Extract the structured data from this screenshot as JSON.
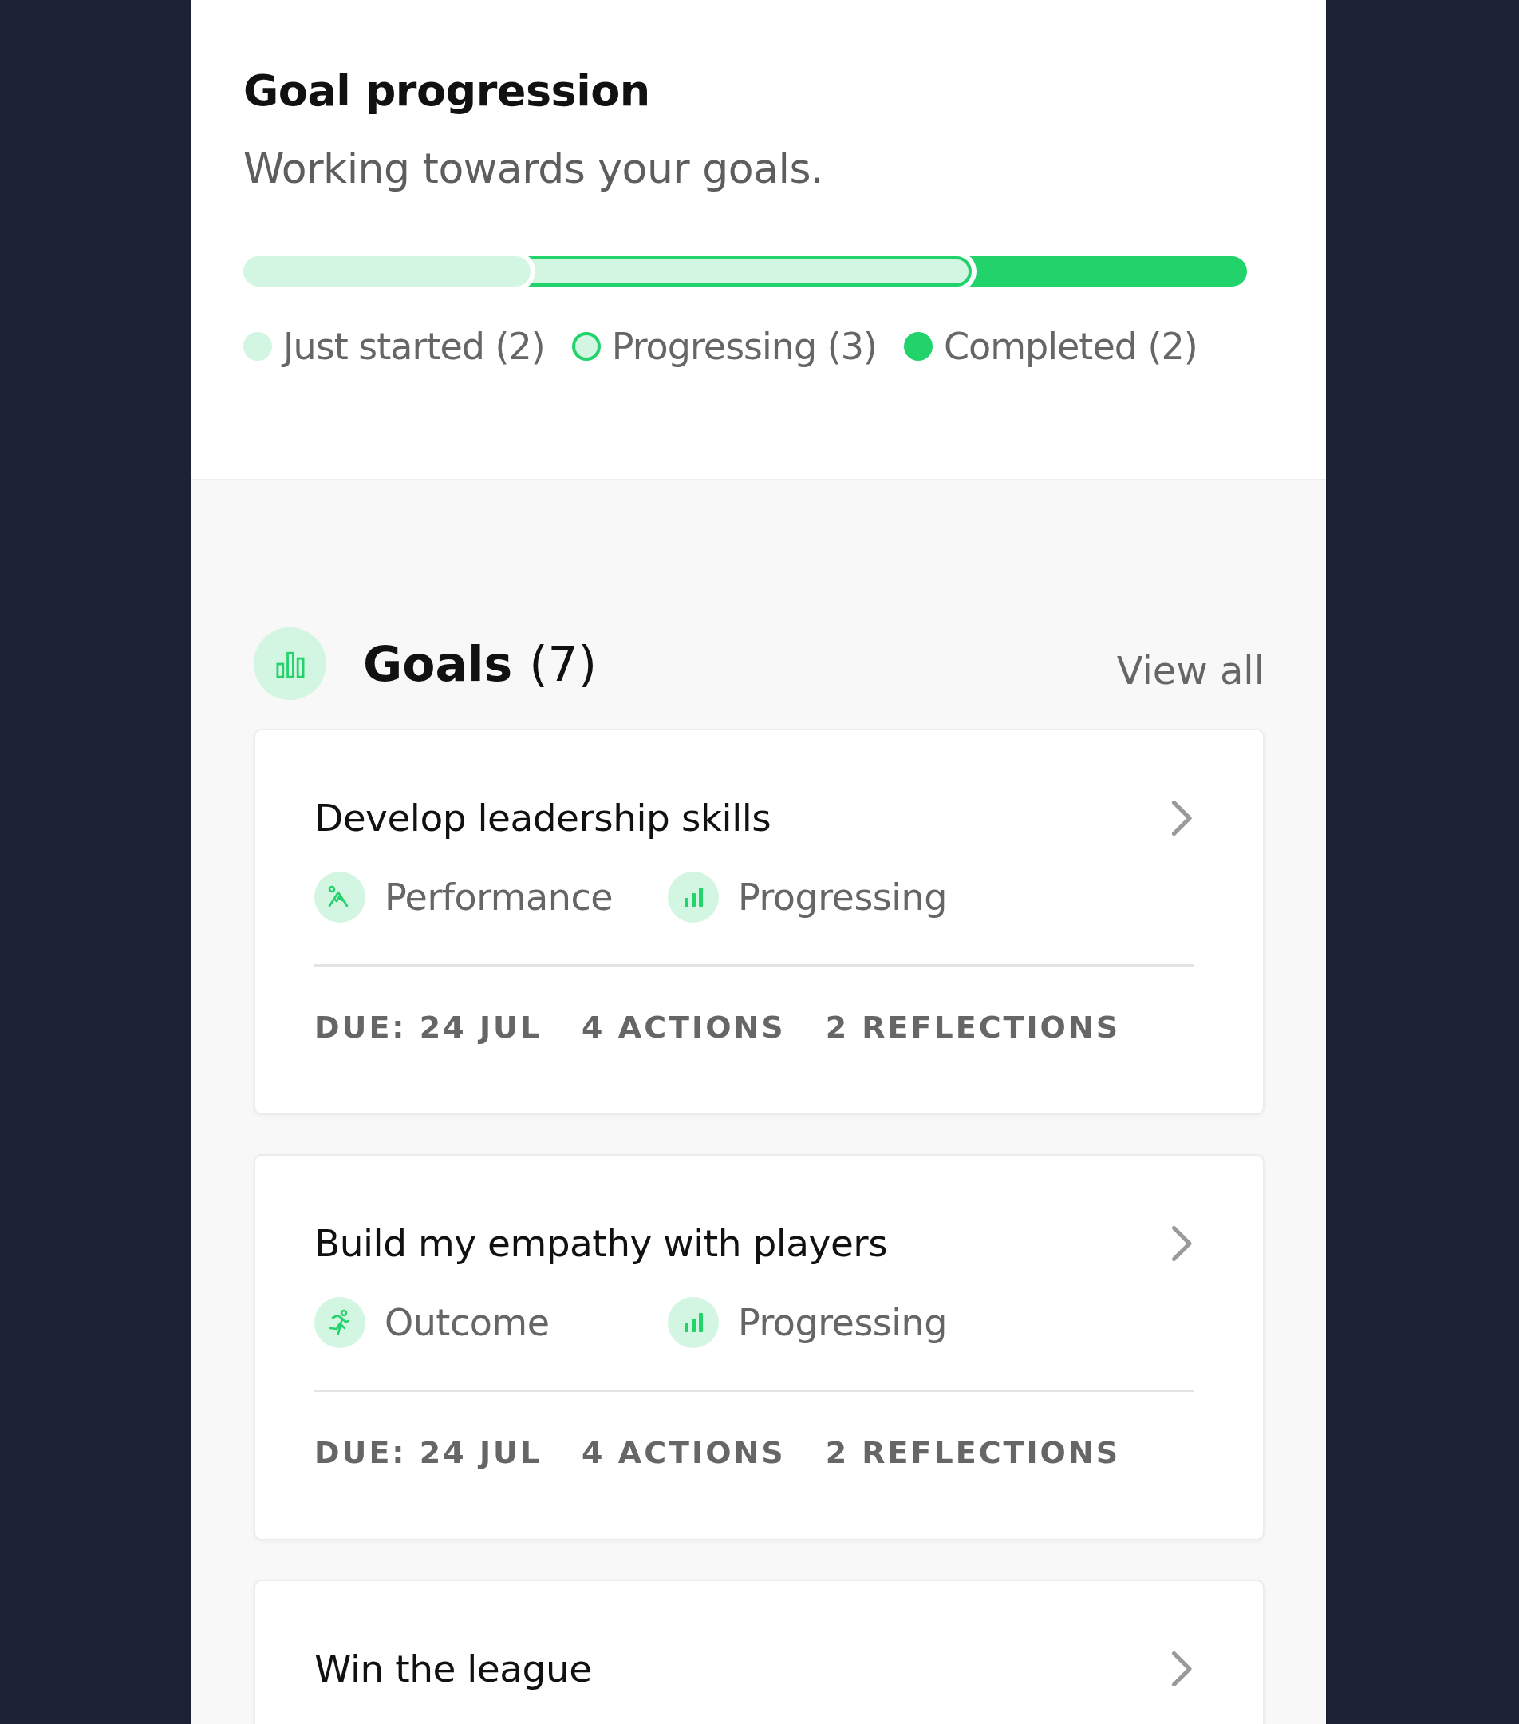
{
  "header": {
    "title": "Goal progression",
    "subtitle": "Working towards your goals."
  },
  "progress": {
    "segments": [
      {
        "kind": "just_started",
        "level": 0.286
      },
      {
        "kind": "progressing",
        "level": 0.726
      }
    ],
    "legend": [
      {
        "kind": "just_started",
        "label": "Just started (2)"
      },
      {
        "kind": "progressing",
        "label": "Progressing (3)"
      },
      {
        "kind": "completed",
        "label": "Completed (2)"
      }
    ]
  },
  "goals": {
    "title": "Goals",
    "count": "(7)",
    "view_all": "View all",
    "cards": [
      {
        "title": "Develop leadership skills",
        "tags": [
          {
            "kind": "performance",
            "label": "Performance"
          },
          {
            "kind": "status",
            "label": "Progressing"
          }
        ],
        "meta": [
          "DUE: 24 JUL",
          "4 ACTIONS",
          "2 REFLECTIONS"
        ]
      },
      {
        "title": "Build my empathy with players",
        "tags": [
          {
            "kind": "outcome",
            "label": "Outcome"
          },
          {
            "kind": "status",
            "label": "Progressing"
          }
        ],
        "meta": [
          "DUE: 24 JUL",
          "4 ACTIONS",
          "2 REFLECTIONS"
        ]
      },
      {
        "title": "Win the league"
      }
    ]
  }
}
